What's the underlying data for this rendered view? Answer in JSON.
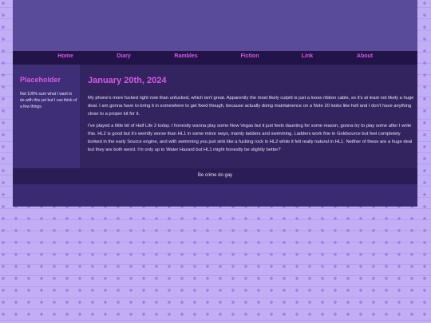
{
  "nav": {
    "items": [
      {
        "label": "Home"
      },
      {
        "label": "Diary"
      },
      {
        "label": "Rambles"
      },
      {
        "label": "Fiction"
      },
      {
        "label": "Link"
      },
      {
        "label": "About"
      }
    ]
  },
  "sidebar": {
    "title": "Placeholder",
    "text": "Not 100% sure what I want to do with this yet but I can think of a few things."
  },
  "post": {
    "date": "January 20th, 2024",
    "paragraph1": "My phone's more fucked right now than unfucked, which isn't great. Apparently the most likely culprit is just a loose ribbon cable, so it's at least not likely a huge deal. I am gonna have to bring it in somewhere to get fixed though, because actually doing maintainence on a Note 20 looks like hell and I don't have anything close to a proper kit for it.",
    "paragraph2": "I've played a little bit of Half Life 2 today. I honestly wanna play some New Vegas but it just feels daunting for some reason, gonna try to play some after I write this. HL2 is good but it's weirdly worse than HL1 in some minor ways, mainly ladders and swimming. Ladders work fine in Goldsource but feel completely borked in the early Source engine, and with swimming you just sink like a fucking rock in HL2 while it felt really natural in HL1. Neither of these are a huge deal but they are both weird. I'm only up to Water Hazard but HL1 might honestly be slightly better?"
  },
  "footer": {
    "text": "Be crime do gay"
  },
  "colors": {
    "accent": "#d35ae6",
    "background": "#c2aef5",
    "panel": "#33245f"
  }
}
